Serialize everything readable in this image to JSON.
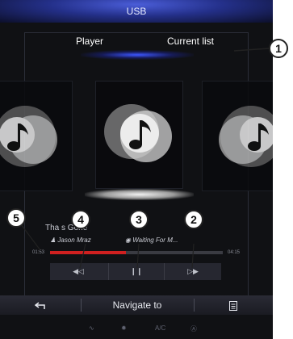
{
  "header": {
    "title": "USB"
  },
  "tabs": [
    {
      "label": "Player"
    },
    {
      "label": "Current list"
    }
  ],
  "now_playing": {
    "title": "Tha s Gone",
    "artist": "Jason Mraz",
    "album": "Waiting For M...",
    "elapsed": "01:53",
    "duration": "04:15",
    "progress_fraction": 0.44
  },
  "controls": {
    "previous_label": "◀◁",
    "pause_label": "❙❙",
    "next_label": "▷▶"
  },
  "bottom_bar": {
    "back_icon": "return-icon",
    "navigate_label": "Navigate to",
    "list_icon": "list-icon"
  },
  "climate_strip": {
    "seat_icon": "seat-heat-icon",
    "fan_icon": "fan-icon",
    "ac_label": "A/C",
    "auto_icon": "auto-climate-icon"
  },
  "callouts": [
    "1",
    "2",
    "3",
    "4",
    "5"
  ],
  "colors": {
    "accent_blue": "#3d56ff",
    "progress_red": "#d02020"
  }
}
